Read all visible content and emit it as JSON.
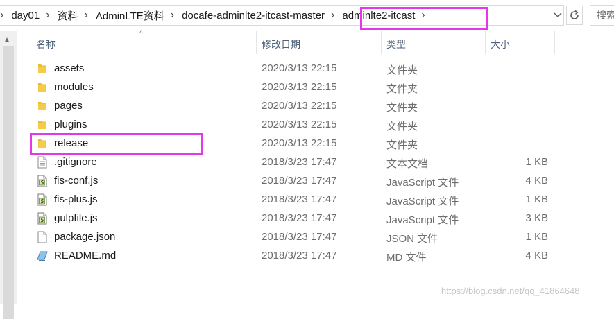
{
  "address_bar": {
    "crumbs": [
      "day01",
      "资料",
      "AdminLTE资料",
      "docafe-adminlte2-itcast-master",
      "adminlte2-itcast"
    ],
    "search_placeholder": "搜索"
  },
  "columns": {
    "name": "名称",
    "date": "修改日期",
    "type": "类型",
    "size": "大小"
  },
  "files": [
    {
      "name": "assets",
      "date": "2020/3/13 22:15",
      "type": "文件夹",
      "size": "",
      "icon": "folder-icon"
    },
    {
      "name": "modules",
      "date": "2020/3/13 22:15",
      "type": "文件夹",
      "size": "",
      "icon": "folder-icon"
    },
    {
      "name": "pages",
      "date": "2020/3/13 22:15",
      "type": "文件夹",
      "size": "",
      "icon": "folder-icon"
    },
    {
      "name": "plugins",
      "date": "2020/3/13 22:15",
      "type": "文件夹",
      "size": "",
      "icon": "folder-icon"
    },
    {
      "name": "release",
      "date": "2020/3/13 22:15",
      "type": "文件夹",
      "size": "",
      "icon": "folder-icon"
    },
    {
      "name": ".gitignore",
      "date": "2018/3/23 17:47",
      "type": "文本文档",
      "size": "1 KB",
      "icon": "text-file-icon"
    },
    {
      "name": "fis-conf.js",
      "date": "2018/3/23 17:47",
      "type": "JavaScript 文件",
      "size": "4 KB",
      "icon": "javascript-file-icon"
    },
    {
      "name": "fis-plus.js",
      "date": "2018/3/23 17:47",
      "type": "JavaScript 文件",
      "size": "1 KB",
      "icon": "javascript-file-icon"
    },
    {
      "name": "gulpfile.js",
      "date": "2018/3/23 17:47",
      "type": "JavaScript 文件",
      "size": "3 KB",
      "icon": "javascript-file-icon"
    },
    {
      "name": "package.json",
      "date": "2018/3/23 17:47",
      "type": "JSON 文件",
      "size": "1 KB",
      "icon": "blank-file-icon"
    },
    {
      "name": "README.md",
      "date": "2018/3/23 17:47",
      "type": "MD 文件",
      "size": "4 KB",
      "icon": "markdown-file-icon"
    }
  ],
  "watermark": "https://blog.csdn.net/qq_41864648",
  "colors": {
    "highlight": "#e238e7",
    "folder": "#f3c43c",
    "header_text": "#4c607a"
  }
}
